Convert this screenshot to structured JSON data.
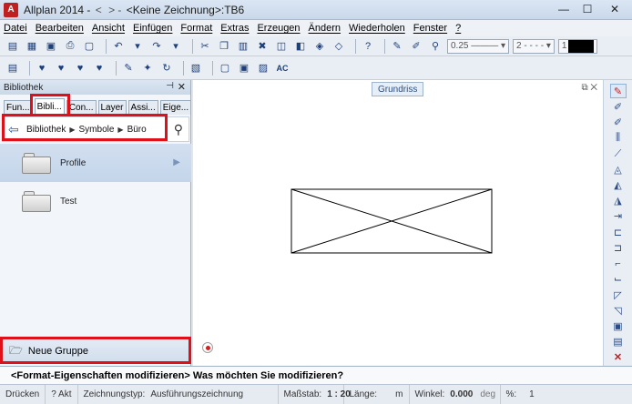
{
  "window": {
    "app_name": "Allplan 2014 -",
    "nav_left": "<",
    "nav_right": "> -",
    "document": "<Keine Zeichnung>:TB6",
    "min": "—",
    "max": "☐",
    "close": "✕"
  },
  "menu": [
    "Datei",
    "Bearbeiten",
    "Ansicht",
    "Einfügen",
    "Format",
    "Extras",
    "Erzeugen",
    "Ändern",
    "Wiederholen",
    "Fenster",
    "?"
  ],
  "toolbar": {
    "pen_value": "0.25",
    "line_value": "2",
    "color_value": "1"
  },
  "toolbar2": {
    "ac_label": "AC"
  },
  "panel": {
    "title": "Bibliothek",
    "tabs": [
      "Fun...",
      "Bibli...",
      "Con...",
      "Layer",
      "Assi...",
      "Eige..."
    ],
    "active_tab": "Bibli...",
    "breadcrumb": [
      "Bibliothek",
      "Symbole",
      "Büro"
    ],
    "items": [
      {
        "label": "Profile",
        "selected": true
      },
      {
        "label": "Test",
        "selected": false
      }
    ],
    "new_group": "Neue Gruppe"
  },
  "canvas": {
    "view_label": "Grundriss"
  },
  "prompt": "<Format-Eigenschaften modifizieren> Was möchten Sie modifizieren?",
  "status": {
    "print": "Drücken",
    "akt": "? Akt",
    "drawing_type_label": "Zeichnungstyp:",
    "drawing_type": "Ausführungszeichnung",
    "scale_label": "Maßstab:",
    "scale": "1 : 20",
    "length_label": "Länge:",
    "length_unit": "m",
    "angle_label": "Winkel:",
    "angle": "0.000",
    "angle_unit": "deg",
    "percent_label": "%:",
    "percent": "1"
  },
  "colors": {
    "highlight": "#e0101a",
    "accent_blue": "#2a5cab"
  }
}
